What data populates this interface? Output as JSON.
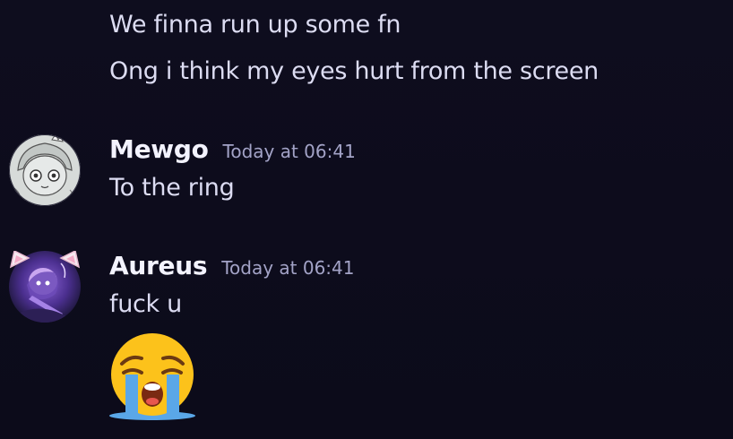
{
  "messages": {
    "continued": [
      "We finna run up some fn",
      "Ong i think my eyes hurt from the screen"
    ],
    "mewgo": {
      "author": "Mewgo",
      "timestamp": "Today at 06:41",
      "text": "To the ring",
      "avatar_icon": "sketch-character-avatar"
    },
    "aureus": {
      "author": "Aureus",
      "timestamp": "Today at 06:41",
      "text": "fuck u",
      "avatar_icon": "cat-ear-anime-avatar",
      "emoji": "loudly-crying-face-emoji"
    }
  },
  "colors": {
    "background": "#0d0c1c",
    "message_text": "#dcdcf2",
    "author_text": "#f3f3ff",
    "timestamp_text": "#a3a3c7"
  }
}
